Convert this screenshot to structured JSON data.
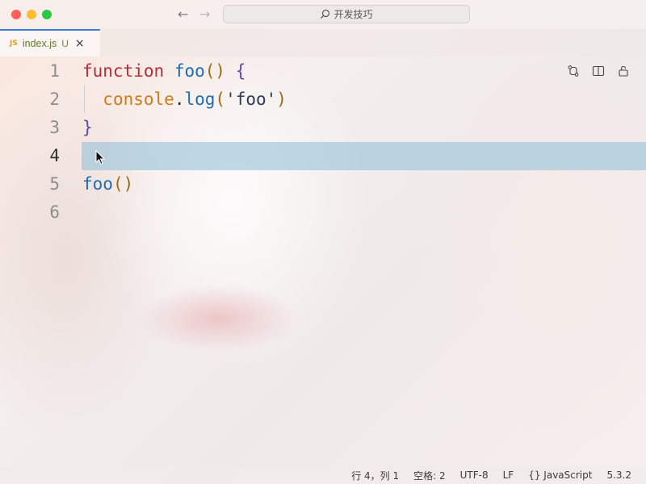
{
  "window": {
    "command_center_text": "开发技巧",
    "nav_back": "←",
    "nav_forward": "→"
  },
  "tab": {
    "icon_text": "JS",
    "filename": "index.js",
    "status": "U",
    "close": "×"
  },
  "editor": {
    "lines": [
      {
        "number": "1",
        "tokens": [
          [
            "function",
            "kw"
          ],
          [
            " ",
            "plain"
          ],
          [
            "foo",
            "fn"
          ],
          [
            "()",
            "paren"
          ],
          [
            " ",
            "plain"
          ],
          [
            "{",
            "brace"
          ]
        ]
      },
      {
        "number": "2",
        "tokens": [
          [
            "  ",
            "plain"
          ],
          [
            "console",
            "obj"
          ],
          [
            ".",
            "plain"
          ],
          [
            "log",
            "fn"
          ],
          [
            "(",
            "paren"
          ],
          [
            "'foo'",
            "str"
          ],
          [
            ")",
            "paren"
          ]
        ]
      },
      {
        "number": "3",
        "tokens": [
          [
            "}",
            "brace"
          ]
        ]
      },
      {
        "number": "4",
        "tokens": []
      },
      {
        "number": "5",
        "tokens": [
          [
            "foo",
            "fn"
          ],
          [
            "()",
            "paren"
          ]
        ]
      },
      {
        "number": "6",
        "tokens": []
      }
    ],
    "current_line": 4
  },
  "statusbar": {
    "position": "行 4，列 1",
    "spaces": "空格: 2",
    "encoding": "UTF-8",
    "eol": "LF",
    "language_icon": "{}",
    "language": "JavaScript",
    "version": "5.3.2"
  },
  "icons": [
    "search-icon",
    "compare-changes-icon",
    "split-editor-icon",
    "lock-icon",
    "mouse-cursor-icon",
    "braces-icon"
  ]
}
